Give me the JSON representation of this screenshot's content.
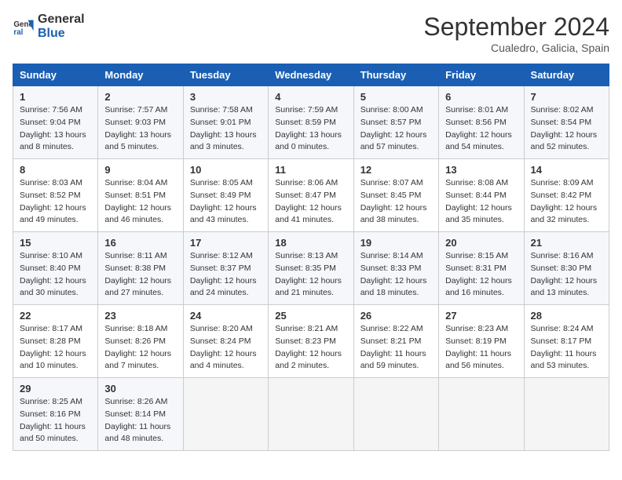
{
  "header": {
    "logo_line1": "General",
    "logo_line2": "Blue",
    "title": "September 2024",
    "location": "Cualedro, Galicia, Spain"
  },
  "days_of_week": [
    "Sunday",
    "Monday",
    "Tuesday",
    "Wednesday",
    "Thursday",
    "Friday",
    "Saturday"
  ],
  "weeks": [
    [
      {
        "day": "1",
        "sunrise": "Sunrise: 7:56 AM",
        "sunset": "Sunset: 9:04 PM",
        "daylight": "Daylight: 13 hours and 8 minutes."
      },
      {
        "day": "2",
        "sunrise": "Sunrise: 7:57 AM",
        "sunset": "Sunset: 9:03 PM",
        "daylight": "Daylight: 13 hours and 5 minutes."
      },
      {
        "day": "3",
        "sunrise": "Sunrise: 7:58 AM",
        "sunset": "Sunset: 9:01 PM",
        "daylight": "Daylight: 13 hours and 3 minutes."
      },
      {
        "day": "4",
        "sunrise": "Sunrise: 7:59 AM",
        "sunset": "Sunset: 8:59 PM",
        "daylight": "Daylight: 13 hours and 0 minutes."
      },
      {
        "day": "5",
        "sunrise": "Sunrise: 8:00 AM",
        "sunset": "Sunset: 8:57 PM",
        "daylight": "Daylight: 12 hours and 57 minutes."
      },
      {
        "day": "6",
        "sunrise": "Sunrise: 8:01 AM",
        "sunset": "Sunset: 8:56 PM",
        "daylight": "Daylight: 12 hours and 54 minutes."
      },
      {
        "day": "7",
        "sunrise": "Sunrise: 8:02 AM",
        "sunset": "Sunset: 8:54 PM",
        "daylight": "Daylight: 12 hours and 52 minutes."
      }
    ],
    [
      {
        "day": "8",
        "sunrise": "Sunrise: 8:03 AM",
        "sunset": "Sunset: 8:52 PM",
        "daylight": "Daylight: 12 hours and 49 minutes."
      },
      {
        "day": "9",
        "sunrise": "Sunrise: 8:04 AM",
        "sunset": "Sunset: 8:51 PM",
        "daylight": "Daylight: 12 hours and 46 minutes."
      },
      {
        "day": "10",
        "sunrise": "Sunrise: 8:05 AM",
        "sunset": "Sunset: 8:49 PM",
        "daylight": "Daylight: 12 hours and 43 minutes."
      },
      {
        "day": "11",
        "sunrise": "Sunrise: 8:06 AM",
        "sunset": "Sunset: 8:47 PM",
        "daylight": "Daylight: 12 hours and 41 minutes."
      },
      {
        "day": "12",
        "sunrise": "Sunrise: 8:07 AM",
        "sunset": "Sunset: 8:45 PM",
        "daylight": "Daylight: 12 hours and 38 minutes."
      },
      {
        "day": "13",
        "sunrise": "Sunrise: 8:08 AM",
        "sunset": "Sunset: 8:44 PM",
        "daylight": "Daylight: 12 hours and 35 minutes."
      },
      {
        "day": "14",
        "sunrise": "Sunrise: 8:09 AM",
        "sunset": "Sunset: 8:42 PM",
        "daylight": "Daylight: 12 hours and 32 minutes."
      }
    ],
    [
      {
        "day": "15",
        "sunrise": "Sunrise: 8:10 AM",
        "sunset": "Sunset: 8:40 PM",
        "daylight": "Daylight: 12 hours and 30 minutes."
      },
      {
        "day": "16",
        "sunrise": "Sunrise: 8:11 AM",
        "sunset": "Sunset: 8:38 PM",
        "daylight": "Daylight: 12 hours and 27 minutes."
      },
      {
        "day": "17",
        "sunrise": "Sunrise: 8:12 AM",
        "sunset": "Sunset: 8:37 PM",
        "daylight": "Daylight: 12 hours and 24 minutes."
      },
      {
        "day": "18",
        "sunrise": "Sunrise: 8:13 AM",
        "sunset": "Sunset: 8:35 PM",
        "daylight": "Daylight: 12 hours and 21 minutes."
      },
      {
        "day": "19",
        "sunrise": "Sunrise: 8:14 AM",
        "sunset": "Sunset: 8:33 PM",
        "daylight": "Daylight: 12 hours and 18 minutes."
      },
      {
        "day": "20",
        "sunrise": "Sunrise: 8:15 AM",
        "sunset": "Sunset: 8:31 PM",
        "daylight": "Daylight: 12 hours and 16 minutes."
      },
      {
        "day": "21",
        "sunrise": "Sunrise: 8:16 AM",
        "sunset": "Sunset: 8:30 PM",
        "daylight": "Daylight: 12 hours and 13 minutes."
      }
    ],
    [
      {
        "day": "22",
        "sunrise": "Sunrise: 8:17 AM",
        "sunset": "Sunset: 8:28 PM",
        "daylight": "Daylight: 12 hours and 10 minutes."
      },
      {
        "day": "23",
        "sunrise": "Sunrise: 8:18 AM",
        "sunset": "Sunset: 8:26 PM",
        "daylight": "Daylight: 12 hours and 7 minutes."
      },
      {
        "day": "24",
        "sunrise": "Sunrise: 8:20 AM",
        "sunset": "Sunset: 8:24 PM",
        "daylight": "Daylight: 12 hours and 4 minutes."
      },
      {
        "day": "25",
        "sunrise": "Sunrise: 8:21 AM",
        "sunset": "Sunset: 8:23 PM",
        "daylight": "Daylight: 12 hours and 2 minutes."
      },
      {
        "day": "26",
        "sunrise": "Sunrise: 8:22 AM",
        "sunset": "Sunset: 8:21 PM",
        "daylight": "Daylight: 11 hours and 59 minutes."
      },
      {
        "day": "27",
        "sunrise": "Sunrise: 8:23 AM",
        "sunset": "Sunset: 8:19 PM",
        "daylight": "Daylight: 11 hours and 56 minutes."
      },
      {
        "day": "28",
        "sunrise": "Sunrise: 8:24 AM",
        "sunset": "Sunset: 8:17 PM",
        "daylight": "Daylight: 11 hours and 53 minutes."
      }
    ],
    [
      {
        "day": "29",
        "sunrise": "Sunrise: 8:25 AM",
        "sunset": "Sunset: 8:16 PM",
        "daylight": "Daylight: 11 hours and 50 minutes."
      },
      {
        "day": "30",
        "sunrise": "Sunrise: 8:26 AM",
        "sunset": "Sunset: 8:14 PM",
        "daylight": "Daylight: 11 hours and 48 minutes."
      },
      null,
      null,
      null,
      null,
      null
    ]
  ]
}
